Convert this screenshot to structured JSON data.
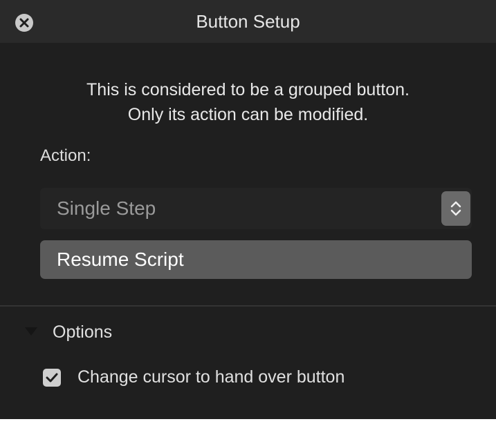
{
  "window": {
    "title": "Button Setup",
    "close_icon": "close-icon"
  },
  "message": {
    "line1": "This is considered to be a grouped button.",
    "line2": "Only its action can be modified."
  },
  "action": {
    "label": "Action:",
    "popup_value": "Single Step",
    "popup_icon": "chevron-up-down-icon",
    "menu_item": "Resume Script"
  },
  "options": {
    "label": "Options",
    "disclosure_icon": "disclosure-triangle-icon",
    "checkbox_label": "Change cursor to hand over button",
    "checkbox_checked": true
  },
  "colors": {
    "window_bg": "#1f1f1f",
    "titlebar_bg": "#2a2a2a",
    "highlight": "#5b5b5b"
  }
}
